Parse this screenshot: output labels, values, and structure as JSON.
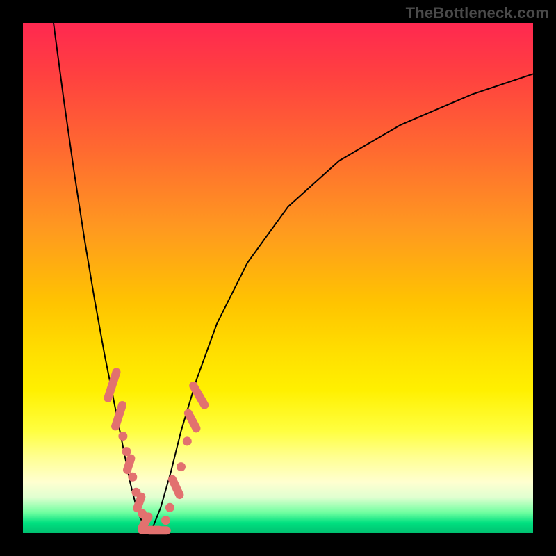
{
  "watermark": "TheBottleneck.com",
  "colors": {
    "marker": "#e2716f",
    "curve": "#000000",
    "frame": "#000000"
  },
  "chart_data": {
    "type": "line",
    "title": "",
    "xlabel": "",
    "ylabel": "",
    "xlim": [
      0,
      100
    ],
    "ylim": [
      0,
      100
    ],
    "grid": false,
    "legend": false,
    "note": "Bottleneck-style V-curve. Axes have no visible tick labels; values are read from relative pixel position and normalized to 0–100. y ≈ 0 marks the bottom (optimal) and y ≈ 100 the top.",
    "series": [
      {
        "name": "left-branch",
        "x": [
          6,
          8,
          10,
          12,
          14,
          16,
          18,
          20,
          21,
          22,
          23,
          24,
          25
        ],
        "y": [
          100,
          85,
          71,
          58,
          46,
          35,
          25,
          15,
          10,
          6,
          3,
          1,
          0
        ]
      },
      {
        "name": "right-branch",
        "x": [
          25,
          27,
          29,
          31,
          34,
          38,
          44,
          52,
          62,
          74,
          88,
          100
        ],
        "y": [
          0,
          5,
          12,
          20,
          30,
          41,
          53,
          64,
          73,
          80,
          86,
          90
        ]
      }
    ],
    "markers": {
      "note": "Salmon-colored sample markers clustered around the trough of the V.",
      "points": [
        {
          "x": 17.5,
          "y": 29,
          "shape": "pill",
          "angle": -72,
          "len": 7
        },
        {
          "x": 18.8,
          "y": 23,
          "shape": "pill",
          "angle": -72,
          "len": 6
        },
        {
          "x": 19.6,
          "y": 19,
          "shape": "dot"
        },
        {
          "x": 20.3,
          "y": 16,
          "shape": "dot"
        },
        {
          "x": 20.8,
          "y": 13.5,
          "shape": "pill",
          "angle": -72,
          "len": 4
        },
        {
          "x": 21.5,
          "y": 11,
          "shape": "dot"
        },
        {
          "x": 22.2,
          "y": 8,
          "shape": "dot"
        },
        {
          "x": 22.8,
          "y": 6,
          "shape": "pill",
          "angle": -70,
          "len": 4
        },
        {
          "x": 23.4,
          "y": 3.8,
          "shape": "dot"
        },
        {
          "x": 24.0,
          "y": 2.2,
          "shape": "pill",
          "angle": -60,
          "len": 4
        },
        {
          "x": 25.0,
          "y": 0.6,
          "shape": "pill",
          "angle": 0,
          "len": 5
        },
        {
          "x": 26.5,
          "y": 0.5,
          "shape": "pill",
          "angle": 0,
          "len": 5
        },
        {
          "x": 28.0,
          "y": 2.5,
          "shape": "dot"
        },
        {
          "x": 28.8,
          "y": 5,
          "shape": "dot"
        },
        {
          "x": 30.0,
          "y": 9,
          "shape": "pill",
          "angle": 65,
          "len": 5
        },
        {
          "x": 31.0,
          "y": 13,
          "shape": "dot"
        },
        {
          "x": 32.2,
          "y": 18,
          "shape": "dot"
        },
        {
          "x": 33.2,
          "y": 22,
          "shape": "pill",
          "angle": 62,
          "len": 5
        },
        {
          "x": 34.5,
          "y": 27,
          "shape": "pill",
          "angle": 60,
          "len": 6
        }
      ]
    }
  }
}
